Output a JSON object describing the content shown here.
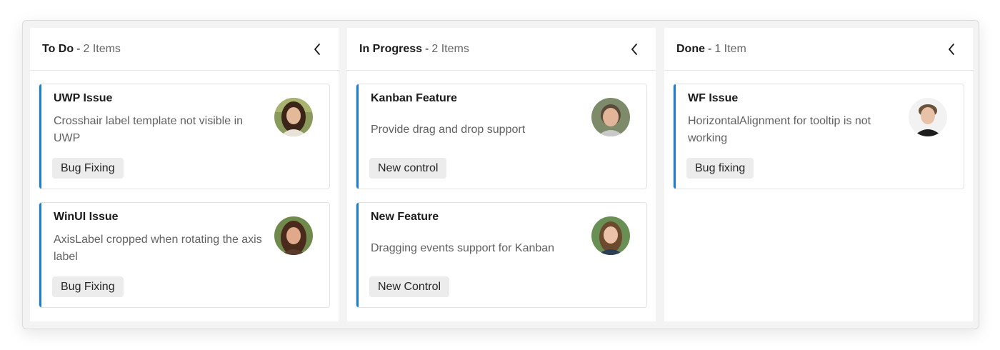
{
  "columns": [
    {
      "title": "To Do",
      "separator": "-",
      "count": "2 Items",
      "cards": [
        {
          "title": "UWP Issue",
          "description": "Crosshair label template not visible in UWP",
          "tag": "Bug Fixing"
        },
        {
          "title": "WinUI Issue",
          "description": "AxisLabel cropped when rotating the axis label",
          "tag": "Bug Fixing"
        }
      ]
    },
    {
      "title": "In Progress",
      "separator": "-",
      "count": "2 Items",
      "cards": [
        {
          "title": "Kanban Feature",
          "description": "Provide drag and drop support",
          "tag": "New control"
        },
        {
          "title": "New Feature",
          "description": "Dragging events support for Kanban",
          "tag": "New Control"
        }
      ]
    },
    {
      "title": "Done",
      "separator": "-",
      "count": "1 Item",
      "cards": [
        {
          "title": "WF Issue",
          "description": "HorizontalAlignment for tooltip is not working",
          "tag": "Bug fixing"
        }
      ]
    }
  ],
  "colors": {
    "accent": "#1a7fd4",
    "board_bg": "#f3f3f3",
    "tag_bg": "#ececec"
  },
  "icons": {
    "collapse": "chevron-left-icon",
    "avatar": "user-avatar"
  }
}
